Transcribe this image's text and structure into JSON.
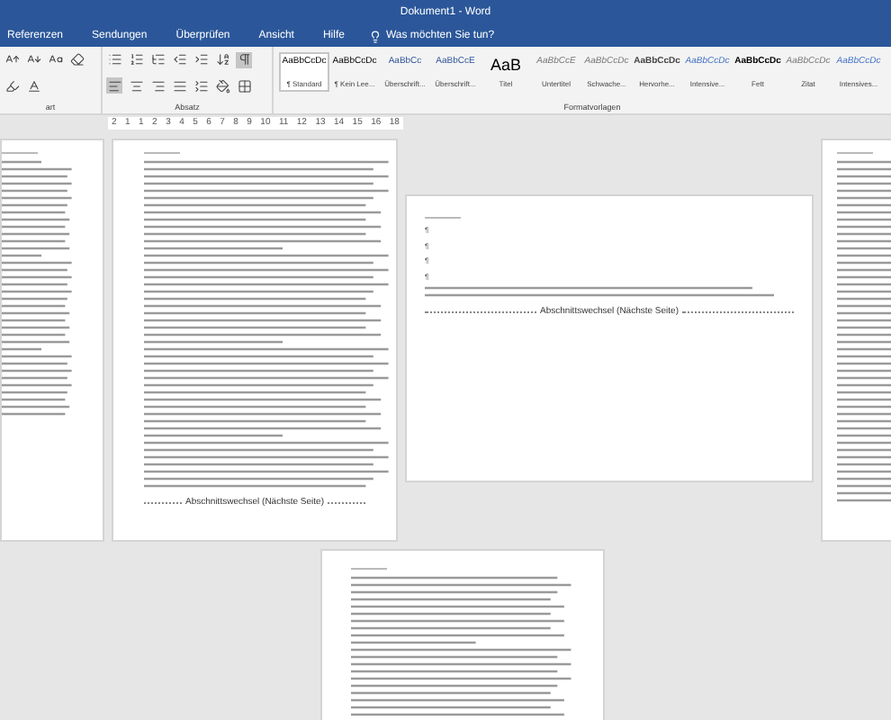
{
  "window": {
    "title": "Dokument1 - Word"
  },
  "tabs": [
    {
      "label": "Referenzen",
      "selected": false
    },
    {
      "label": "Sendungen",
      "selected": false
    },
    {
      "label": "Überprüfen",
      "selected": false
    },
    {
      "label": "Ansicht",
      "selected": false
    },
    {
      "label": "Hilfe",
      "selected": false
    }
  ],
  "tell_me": {
    "placeholder": "Was möchten Sie tun?"
  },
  "ribbon": {
    "show_formatting_marks": true,
    "align_left": true,
    "styles": [
      {
        "preview": "AaBbCcDc",
        "name": "¶ Standard",
        "kind": "normal",
        "selected": true
      },
      {
        "preview": "AaBbCcDc",
        "name": "¶ Kein Lee...",
        "kind": "normal",
        "selected": false
      },
      {
        "preview": "AaBbCc",
        "name": "Überschrift...",
        "kind": "heading",
        "selected": false
      },
      {
        "preview": "AaBbCcE",
        "name": "Überschrift...",
        "kind": "heading2",
        "selected": false
      },
      {
        "preview": "AaB",
        "name": "Titel",
        "kind": "title",
        "selected": false
      },
      {
        "preview": "AaBbCcE",
        "name": "Untertitel",
        "kind": "subtle",
        "selected": false
      },
      {
        "preview": "AaBbCcDc",
        "name": "Schwache...",
        "kind": "subtle",
        "selected": false
      },
      {
        "preview": "AaBbCcDc",
        "name": "Hervorhe...",
        "kind": "emphasis",
        "selected": false
      },
      {
        "preview": "AaBbCcDc",
        "name": "Intensive...",
        "kind": "intense",
        "selected": false
      },
      {
        "preview": "AaBbCcDc",
        "name": "Fett",
        "kind": "strong",
        "selected": false
      },
      {
        "preview": "AaBbCcDc",
        "name": "Zitat",
        "kind": "subtle",
        "selected": false
      },
      {
        "preview": "AaBbCcDc",
        "name": "Intensives...",
        "kind": "intense",
        "selected": false
      }
    ],
    "group_labels": [
      "art",
      "Absatz",
      "Formatvorlagen"
    ]
  },
  "ruler": {
    "labels": [
      "2",
      "1",
      "1",
      "2",
      "3",
      "4",
      "5",
      "6",
      "7",
      "8",
      "9",
      "10",
      "11",
      "12",
      "13",
      "14",
      "15",
      "16",
      "18"
    ]
  },
  "pages": [
    {
      "kind": "portrait"
    },
    {
      "kind": "portrait",
      "section_break": "Abschnittswechsel (Nächste Seite)"
    },
    {
      "kind": "landscape",
      "paragraph_marks": [
        "¶",
        "¶",
        "¶",
        "¶"
      ],
      "section_break": "Abschnittswechsel (Nächste Seite)"
    },
    {
      "kind": "narrow"
    },
    {
      "kind": "bottom"
    }
  ]
}
